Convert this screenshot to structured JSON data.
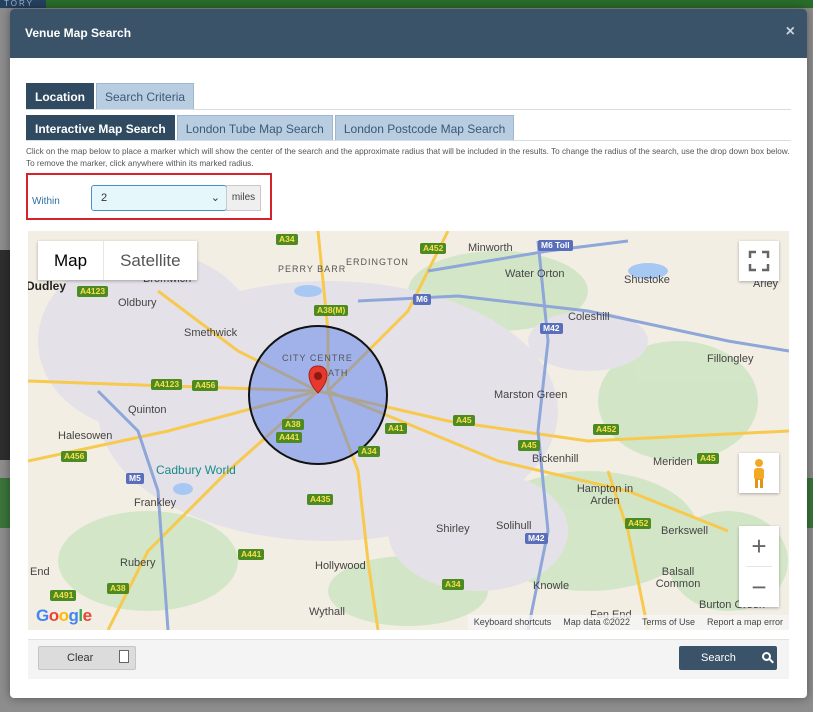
{
  "background": {
    "logo_fragment": "TORY"
  },
  "modal": {
    "title": "Venue Map Search",
    "close_label": "×"
  },
  "tabs_main": [
    {
      "label": "Location",
      "active": true
    },
    {
      "label": "Search Criteria",
      "active": false
    }
  ],
  "tabs_location": [
    {
      "label": "Interactive Map Search",
      "active": true
    },
    {
      "label": "London Tube Map Search",
      "active": false
    },
    {
      "label": "London Postcode Map Search",
      "active": false
    }
  ],
  "instructions": "Click on the map below to place a marker which will show the center of the search and the approximate radius that will be included in the results. To change the radius of the search, use the drop down box below. To remove the marker, click anywhere within its marked radius.",
  "radius": {
    "label": "Within",
    "value": "2",
    "units": "miles"
  },
  "map": {
    "type_map": "Map",
    "type_satellite": "Satellite",
    "zoom_in": "+",
    "zoom_out": "−",
    "google": "Google",
    "attribution": [
      "Keyboard shortcuts",
      "Map data ©2022",
      "Terms of Use",
      "Report a map error"
    ],
    "places": [
      "Minworth",
      "Water Orton",
      "ERDINGTON",
      "PERRY BARR",
      "Shustoke",
      "Arley",
      "Oldbury",
      "Coleshill",
      "Smethwick",
      "Fillongley",
      "CITY CENTRE",
      "Marston Green",
      "Quinton",
      "Halesowen",
      "Cadbury World",
      "Bickenhill",
      "Meriden",
      "Hampton in Arden",
      "Frankley",
      "Shirley",
      "Solihull",
      "Berkswell",
      "Rubery",
      "Hollywood",
      "Knowle",
      "Balsall Common",
      "Wythall",
      "Burton Green",
      "Fen End",
      "Dudley",
      "Bromwich",
      "End",
      "ATH"
    ],
    "roads": [
      "A34",
      "A452",
      "M6 Toll",
      "A4123",
      "A38(M)",
      "M6",
      "M42",
      "A4123",
      "A456",
      "A38",
      "A441",
      "A45",
      "A41",
      "A34",
      "A45",
      "A452",
      "A456",
      "M5",
      "A435",
      "A441",
      "M42",
      "A452",
      "A34",
      "A38",
      "A491",
      "A45"
    ]
  },
  "footer": {
    "clear_label": "Clear",
    "search_label": "Search"
  }
}
